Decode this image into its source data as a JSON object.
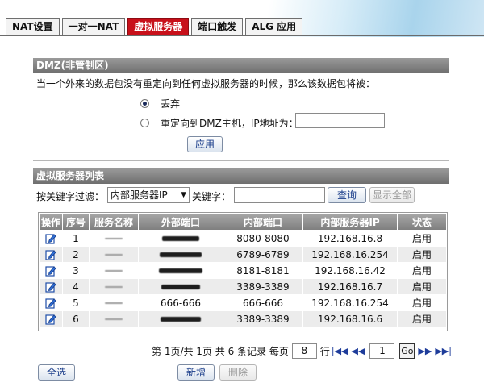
{
  "tabs": [
    "NAT设置",
    "一对一NAT",
    "虚拟服务器",
    "端口触发",
    "ALG 应用"
  ],
  "dmz": {
    "title": "DMZ(非管制区)",
    "description": "当一个外来的数据包没有重定向到任何虚拟服务器的时候，那么该数据包将被：",
    "option_drop": "丢弃",
    "option_redirect": "重定向到DMZ主机，IP地址为：",
    "selected_option": "丢弃",
    "ip_value": "",
    "apply_label": "应用"
  },
  "vs": {
    "title": "虚拟服务器列表",
    "filter_label": "按关键字过滤：",
    "filter_select": "内部服务器IP",
    "keyword_label": "关键字：",
    "keyword_value": "",
    "query_label": "查询",
    "show_all_label": "显示全部",
    "columns": [
      "操作",
      "序号",
      "服务名称",
      "外部端口",
      "内部端口",
      "内部服务器IP",
      "状态"
    ],
    "rows": [
      {
        "index": "1",
        "internal_port": "8080-8080",
        "ip": "192.168.16.8",
        "status": "启用"
      },
      {
        "index": "2",
        "internal_port": "6789-6789",
        "ip": "192.168.16.254",
        "status": "启用"
      },
      {
        "index": "3",
        "internal_port": "8181-8181",
        "ip": "192.168.16.42",
        "status": "启用"
      },
      {
        "index": "4",
        "internal_port": "3389-3389",
        "ip": "192.168.16.7",
        "status": "启用"
      },
      {
        "index": "5",
        "external_port": "666-666",
        "internal_port": "666-666",
        "ip": "192.168.16.254",
        "status": "启用"
      },
      {
        "index": "6",
        "internal_port": "3389-3389",
        "ip": "192.168.16.6",
        "status": "启用"
      }
    ]
  },
  "pager": {
    "page_info": "第 1页/共 1页 共 6 条记录 每页",
    "per_page": "8",
    "row_unit": "行",
    "page_input": "1",
    "go_label": "Go"
  },
  "actions": {
    "select_all": "全选",
    "add": "新增",
    "delete": "删除"
  },
  "colors": {
    "active_tab": "#c8101a",
    "section_header": "#7e7e7e",
    "link_blue": "#1a3d8a"
  }
}
